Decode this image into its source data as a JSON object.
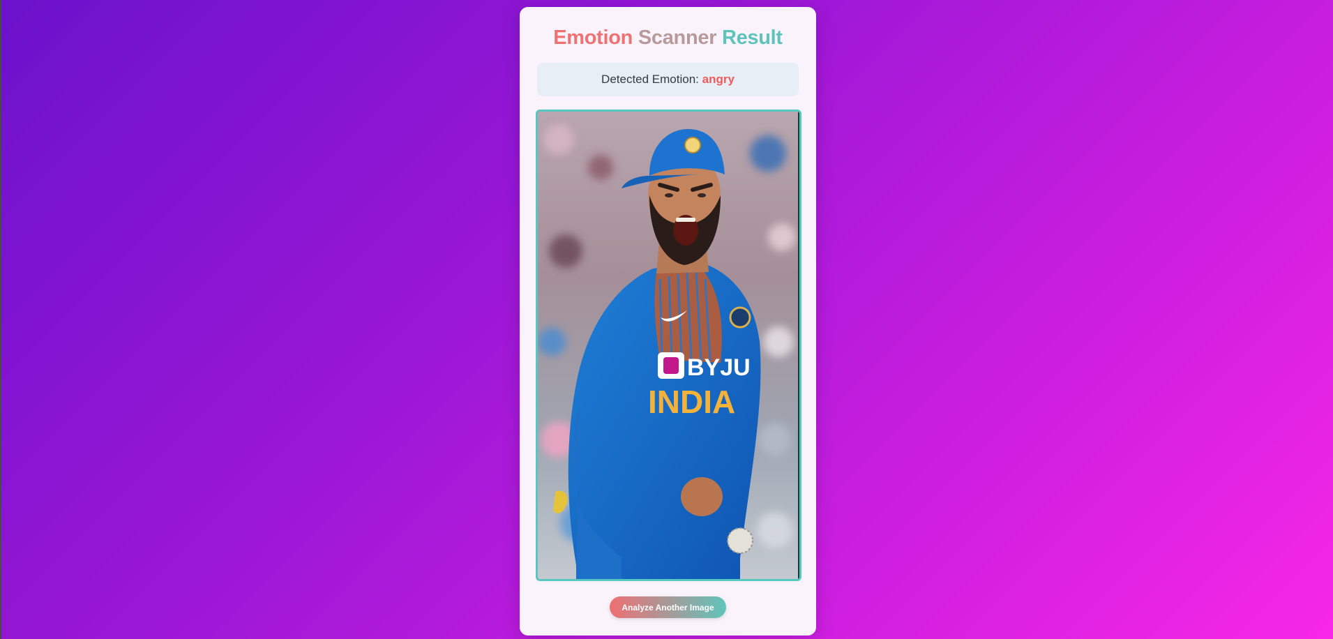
{
  "header": {
    "title_word_1": "Emotion",
    "title_word_2": "Scanner",
    "title_word_3": "Result"
  },
  "result": {
    "label": "Detected Emotion:",
    "emotion": "angry"
  },
  "image": {
    "jersey_sponsor": "BYJU",
    "jersey_text": "INDIA"
  },
  "actions": {
    "analyze_another_label": "Analyze Another Image"
  },
  "colors": {
    "title_1": "#ee7272",
    "title_2": "#b79a99",
    "title_3": "#5ec4bb",
    "emotion": "#ef5b5b",
    "image_border": "#57c8c0"
  }
}
